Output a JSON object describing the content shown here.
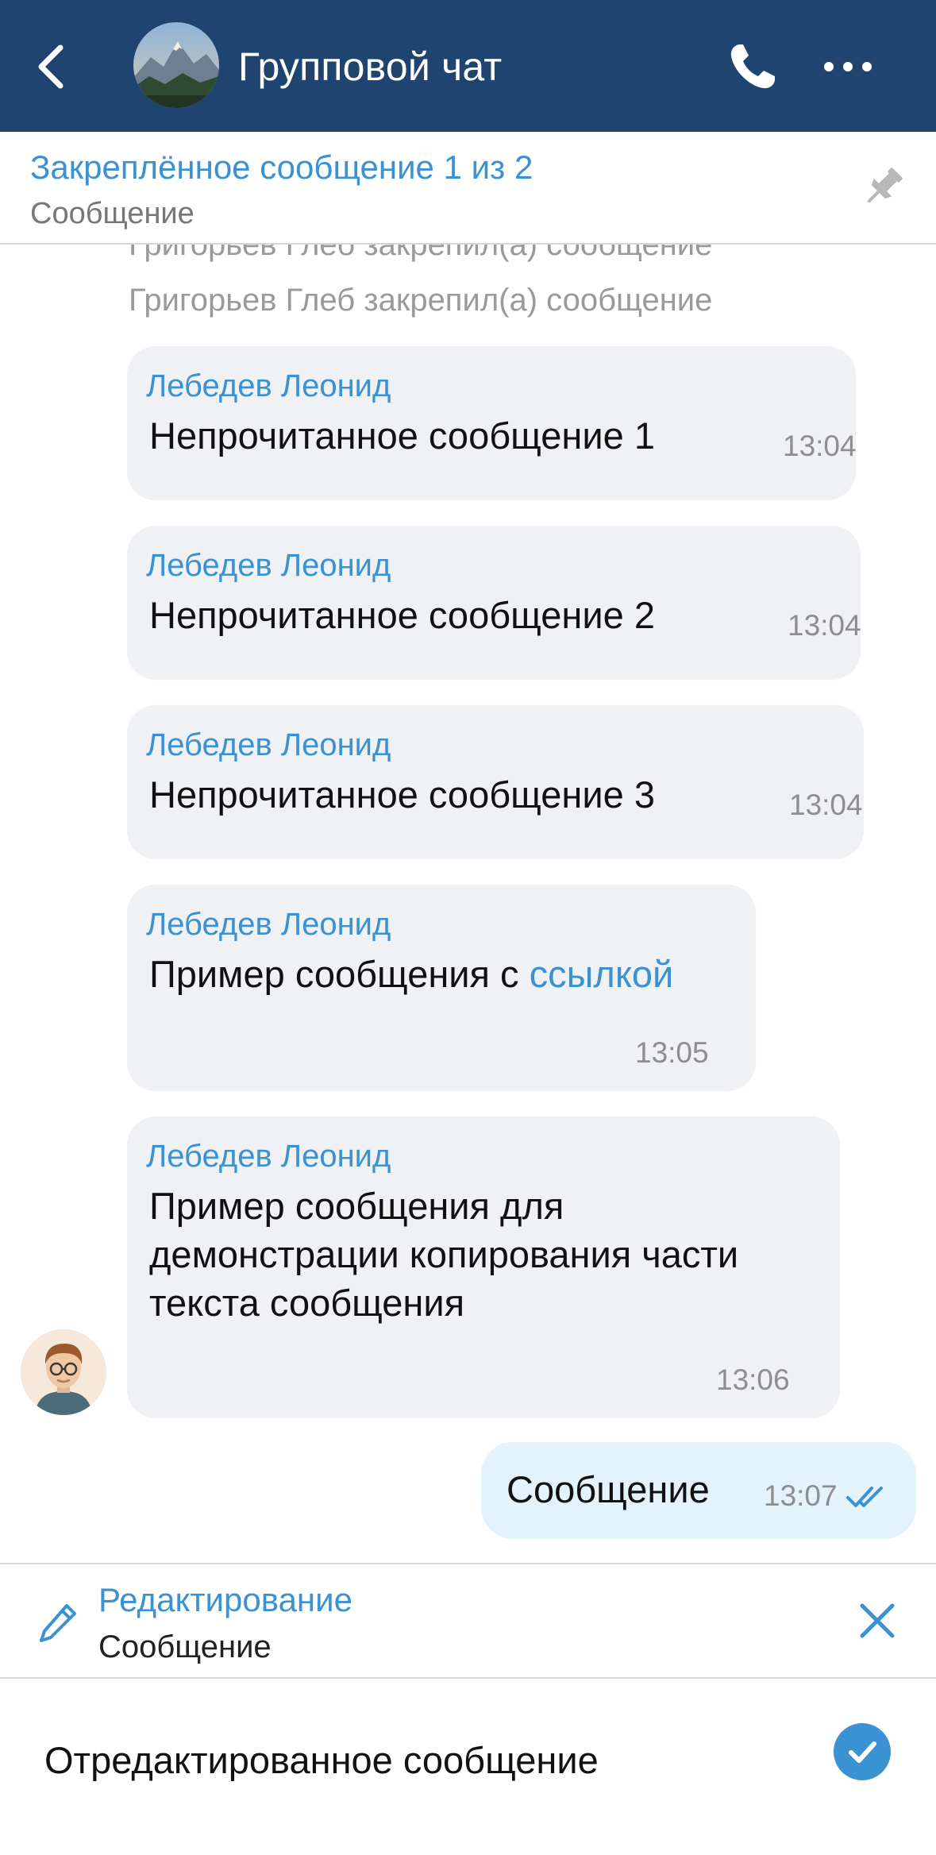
{
  "header": {
    "title": "Групповой чат",
    "background": "#1f4470"
  },
  "pinned": {
    "title": "Закреплённое сообщение 1 из 2",
    "text": "Сообщение"
  },
  "system_messages": [
    "Григорьев Глеб закрепил(а) сообщение",
    "Григорьев Глеб закрепил(а) сообщение"
  ],
  "messages": [
    {
      "sender": "Лебедев Леонид",
      "text": "Непрочитанное сообщение 1",
      "time": "13:04"
    },
    {
      "sender": "Лебедев Леонид",
      "text": "Непрочитанное сообщение 2",
      "time": "13:04"
    },
    {
      "sender": "Лебедев Леонид",
      "text": "Непрочитанное сообщение 3",
      "time": "13:04"
    },
    {
      "sender": "Лебедев Леонид",
      "text_before_link": "Пример сообщения с ",
      "link_text": "ссылкой",
      "time": "13:05"
    },
    {
      "sender": "Лебедев Леонид",
      "text": "Пример сообщения для демонстрации копирования части текста сообщения",
      "time": "13:06"
    }
  ],
  "outgoing": {
    "text": "Сообщение",
    "time": "13:07",
    "status_icon": "double-check-icon"
  },
  "edit": {
    "title": "Редактирование",
    "text": "Сообщение"
  },
  "composer": {
    "value": "Отредактированное сообщение"
  },
  "colors": {
    "accent": "#3a92d2",
    "incoming_bubble": "#f0f1f4",
    "outgoing_bubble": "#e3f2fb"
  },
  "icons": {
    "back": "chevron-left-icon",
    "call": "phone-icon",
    "more": "more-icon",
    "pin": "pin-icon",
    "edit": "pencil-icon",
    "close": "close-icon",
    "send": "check-icon"
  }
}
